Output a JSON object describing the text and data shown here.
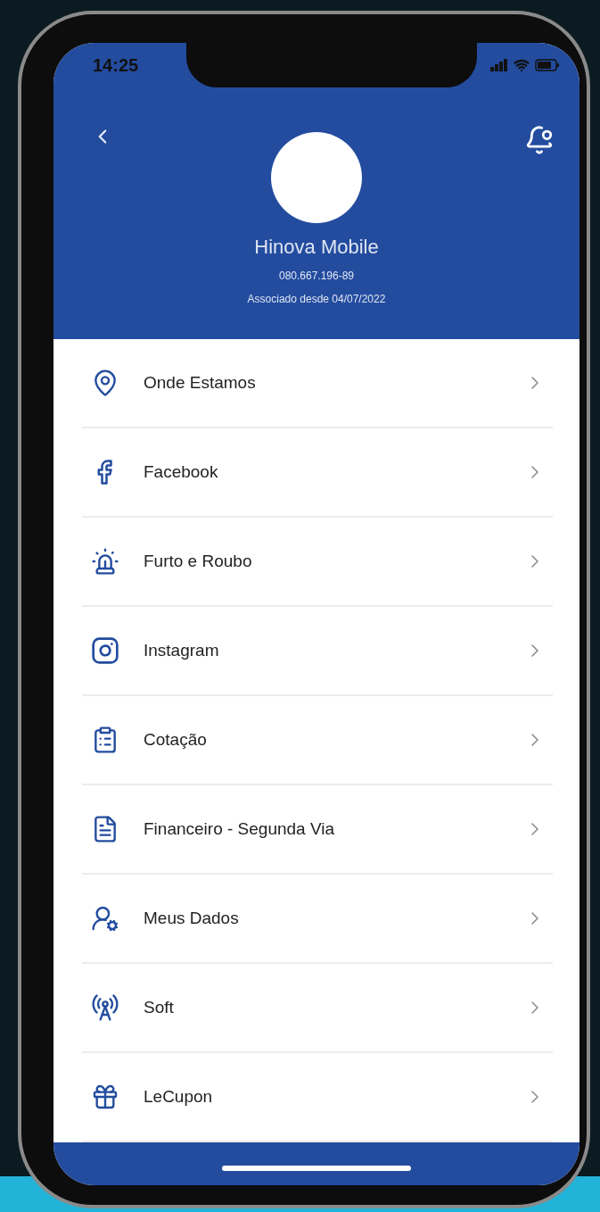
{
  "status_bar": {
    "time": "14:25"
  },
  "profile": {
    "name": "Hinova Mobile",
    "document": "080.667.196-89",
    "member_since": "Associado desde 04/07/2022"
  },
  "menu_items": [
    {
      "label": "Onde Estamos",
      "kind": "location"
    },
    {
      "label": "Facebook",
      "kind": "facebook"
    },
    {
      "label": "Furto e Roubo",
      "kind": "alarm"
    },
    {
      "label": "Instagram",
      "kind": "instagram"
    },
    {
      "label": "Cotação",
      "kind": "quote"
    },
    {
      "label": "Financeiro - Segunda Via",
      "kind": "invoice"
    },
    {
      "label": "Meus Dados",
      "kind": "profile"
    },
    {
      "label": "Soft",
      "kind": "antenna"
    },
    {
      "label": "LeCupon",
      "kind": "gift"
    }
  ]
}
